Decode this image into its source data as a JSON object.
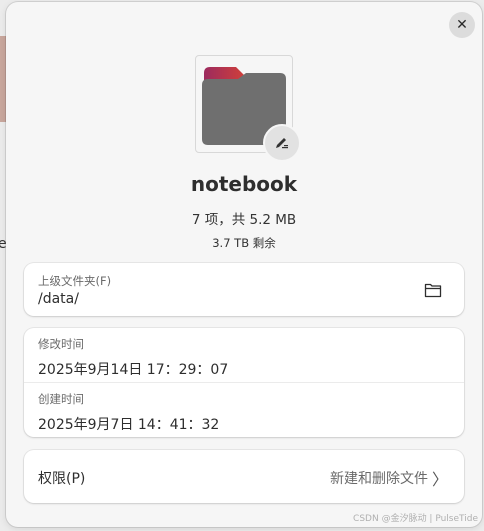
{
  "dialog": {
    "name": "notebook",
    "summary": "7 项，共 5.2 MB",
    "free_space": "3.7 TB 剩余"
  },
  "parent_folder": {
    "label": "上级文件夹(F)",
    "value": "/data/"
  },
  "modified": {
    "label": "修改时间",
    "value": "2025年9月14日 17：29：07"
  },
  "created": {
    "label": "创建时间",
    "value": "2025年9月7日 14：41：32"
  },
  "permissions": {
    "label": "权限(P)",
    "value": "新建和删除文件"
  },
  "icons": {
    "close": "close-icon",
    "folder": "folder-icon",
    "edit": "edit-pencil-icon",
    "open_folder": "open-folder-icon",
    "chevron": "chevron-right-icon"
  },
  "colors": {
    "folder_tab": "#d13b3b",
    "folder_body": "#6f6f6f"
  },
  "background": {
    "partial_char": "e"
  },
  "watermark": "CSDN @金汐脉动 | PulseTide"
}
